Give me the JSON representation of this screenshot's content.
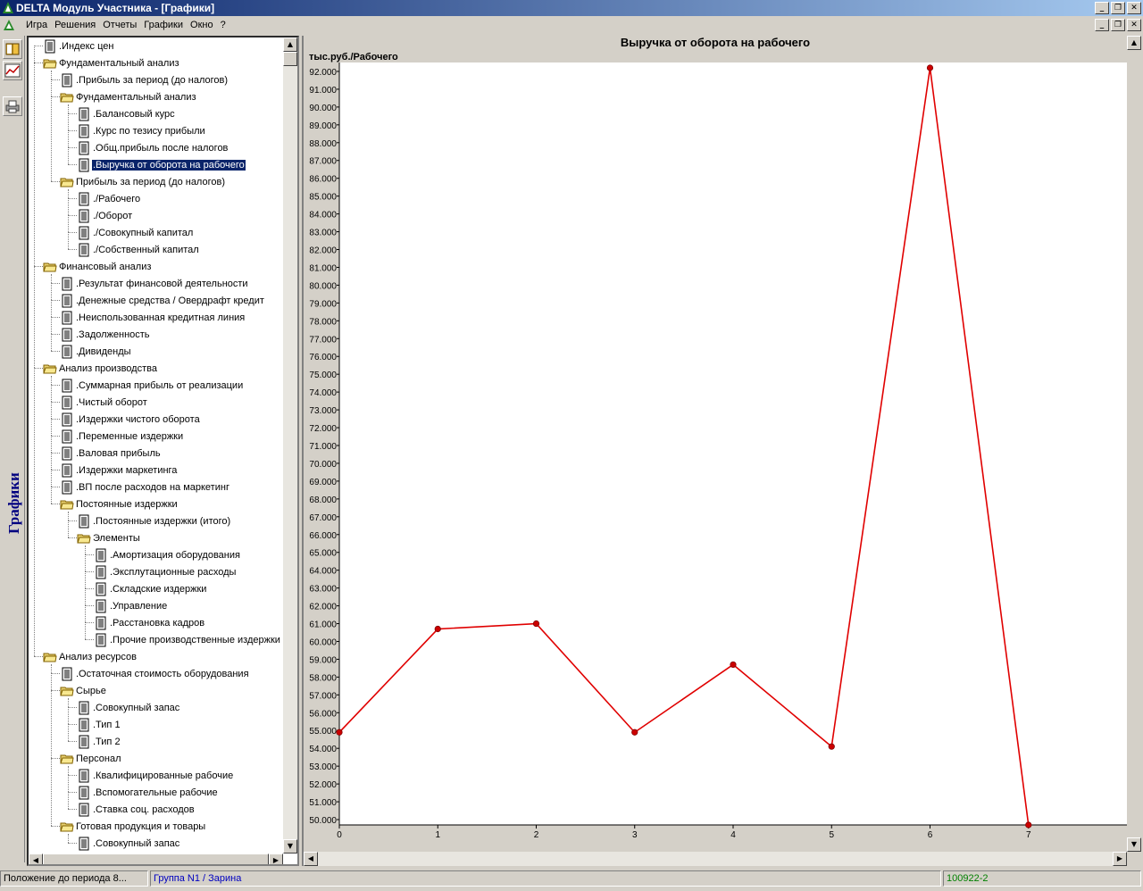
{
  "window": {
    "title": "DELTA Модуль Участника - [Графики]",
    "btn_min": "_",
    "btn_max": "❐",
    "btn_close": "✕"
  },
  "menu": [
    "Игра",
    "Решения",
    "Отчеты",
    "Графики",
    "Окно",
    "?"
  ],
  "sidebar": {
    "vertical_label": "Графики",
    "buttons": [
      "book-icon",
      "chart-icon",
      "printer-icon"
    ]
  },
  "tree": [
    {
      "label": ".Индекс цен",
      "depth": 0,
      "type": "doc"
    },
    {
      "label": "Фундаментальный анализ",
      "depth": 0,
      "type": "folder"
    },
    {
      "label": ".Прибыль за период (до налогов)",
      "depth": 1,
      "type": "doc"
    },
    {
      "label": "Фундаментальный анализ",
      "depth": 1,
      "type": "folder"
    },
    {
      "label": ".Балансовый курс",
      "depth": 2,
      "type": "doc"
    },
    {
      "label": ".Курс по тезису прибыли",
      "depth": 2,
      "type": "doc"
    },
    {
      "label": ".Общ.прибыль после налогов",
      "depth": 2,
      "type": "doc"
    },
    {
      "label": ".Выручка от оборота на рабочего",
      "depth": 2,
      "type": "doc",
      "selected": true
    },
    {
      "label": "Прибыль за период (до налогов)",
      "depth": 1,
      "type": "folder"
    },
    {
      "label": "./Рабочего",
      "depth": 2,
      "type": "doc"
    },
    {
      "label": "./Оборот",
      "depth": 2,
      "type": "doc"
    },
    {
      "label": "./Совокупный капитал",
      "depth": 2,
      "type": "doc"
    },
    {
      "label": "./Собственный капитал",
      "depth": 2,
      "type": "doc"
    },
    {
      "label": "Финансовый анализ",
      "depth": 0,
      "type": "folder"
    },
    {
      "label": ".Результат финансовой деятельности",
      "depth": 1,
      "type": "doc"
    },
    {
      "label": ".Денежные средства / Овердрафт кредит",
      "depth": 1,
      "type": "doc"
    },
    {
      "label": ".Неиспользованная кредитная линия",
      "depth": 1,
      "type": "doc"
    },
    {
      "label": ".Задолженность",
      "depth": 1,
      "type": "doc"
    },
    {
      "label": ".Дивиденды",
      "depth": 1,
      "type": "doc"
    },
    {
      "label": "Анализ производства",
      "depth": 0,
      "type": "folder"
    },
    {
      "label": ".Суммарная прибыль от реализации",
      "depth": 1,
      "type": "doc"
    },
    {
      "label": ".Чистый оборот",
      "depth": 1,
      "type": "doc"
    },
    {
      "label": ".Издержки чистого оборота",
      "depth": 1,
      "type": "doc"
    },
    {
      "label": ".Переменные издержки",
      "depth": 1,
      "type": "doc"
    },
    {
      "label": ".Валовая прибыль",
      "depth": 1,
      "type": "doc"
    },
    {
      "label": ".Издержки маркетинга",
      "depth": 1,
      "type": "doc"
    },
    {
      "label": ".ВП после расходов на маркетинг",
      "depth": 1,
      "type": "doc"
    },
    {
      "label": "Постоянные издержки",
      "depth": 1,
      "type": "folder"
    },
    {
      "label": ".Постоянные издержки (итого)",
      "depth": 2,
      "type": "doc"
    },
    {
      "label": "Элементы",
      "depth": 2,
      "type": "folder"
    },
    {
      "label": ".Амортизация оборудования",
      "depth": 3,
      "type": "doc"
    },
    {
      "label": ".Эксплутационные расходы",
      "depth": 3,
      "type": "doc"
    },
    {
      "label": ".Складские издержки",
      "depth": 3,
      "type": "doc"
    },
    {
      "label": ".Управление",
      "depth": 3,
      "type": "doc"
    },
    {
      "label": ".Расстановка кадров",
      "depth": 3,
      "type": "doc"
    },
    {
      "label": ".Прочие производственные издержки",
      "depth": 3,
      "type": "doc"
    },
    {
      "label": "Анализ ресурсов",
      "depth": 0,
      "type": "folder"
    },
    {
      "label": ".Остаточная стоимость оборудования",
      "depth": 1,
      "type": "doc"
    },
    {
      "label": "Сырье",
      "depth": 1,
      "type": "folder"
    },
    {
      "label": ".Совокупный запас",
      "depth": 2,
      "type": "doc"
    },
    {
      "label": ".Тип 1",
      "depth": 2,
      "type": "doc"
    },
    {
      "label": ".Тип 2",
      "depth": 2,
      "type": "doc"
    },
    {
      "label": "Персонал",
      "depth": 1,
      "type": "folder"
    },
    {
      "label": ".Квалифицированные рабочие",
      "depth": 2,
      "type": "doc"
    },
    {
      "label": ".Вспомогательные рабочие",
      "depth": 2,
      "type": "doc"
    },
    {
      "label": ".Ставка соц. расходов",
      "depth": 2,
      "type": "doc"
    },
    {
      "label": "Готовая продукция и товары",
      "depth": 1,
      "type": "folder"
    },
    {
      "label": ".Совокупный запас",
      "depth": 2,
      "type": "doc"
    }
  ],
  "scroll": {
    "up": "▲",
    "down": "▼",
    "left": "◀",
    "right": "▶"
  },
  "status": {
    "left": "Положение до периода 8...",
    "group": "Группа N1 / Зарина",
    "code": "100922-2"
  },
  "colors": {
    "line": "#e00000",
    "marker": "#cc0000",
    "selected": "#0a246a",
    "group_text": "#0000c0",
    "code_text": "#008000"
  },
  "chart_data": {
    "type": "line",
    "title": "Выручка от оборота на рабочего",
    "ylabel": "тыс.руб./Рабочего",
    "xlabel": "",
    "x": [
      0,
      1,
      2,
      3,
      4,
      5,
      6,
      7
    ],
    "values": [
      54.9,
      60.7,
      61.0,
      54.9,
      58.7,
      54.1,
      92.2,
      49.7
    ],
    "xlim": [
      0,
      8
    ],
    "ylim": [
      49.7,
      92.5
    ],
    "yticks": [
      50,
      51,
      52,
      53,
      54,
      55,
      56,
      57,
      58,
      59,
      60,
      61,
      62,
      63,
      64,
      65,
      66,
      67,
      68,
      69,
      70,
      71,
      72,
      73,
      74,
      75,
      76,
      77,
      78,
      79,
      80,
      81,
      82,
      83,
      84,
      85,
      86,
      87,
      88,
      89,
      90,
      91,
      92
    ],
    "ytick_format": "000",
    "xticks": [
      0,
      1,
      2,
      3,
      4,
      5,
      6,
      7
    ],
    "grid": false,
    "legend": "none"
  }
}
